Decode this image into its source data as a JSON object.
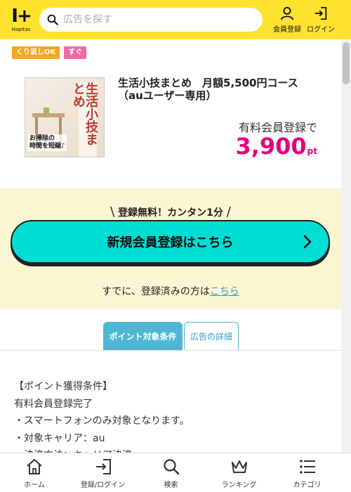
{
  "header": {
    "logo_mark": "I+",
    "logo_word": "Hapitas",
    "search_placeholder": "広告を探す",
    "register_label": "会員登録",
    "login_label": "ログイン"
  },
  "tags": [
    "くり返しOK",
    "すぐ"
  ],
  "product": {
    "image_title": "生活小技まとめ",
    "image_sub": "お掃除の\n時間を短縮♪",
    "title": "生活小技まとめ　月額5,500円コース（auユーザー専用）",
    "reward_label": "有料会員登録で",
    "points": "3,900",
    "points_unit": "pt"
  },
  "registration": {
    "catch": "登録無料！カンタン1分",
    "cta_label": "新規会員登録はこちら",
    "already_text": "すでに、登録済みの方は",
    "already_link": "こちら"
  },
  "tabs": [
    "ポイント対象条件",
    "広告の詳細"
  ],
  "conditions": [
    "【ポイント獲得条件】",
    "有料会員登録完了",
    "・スマートフォンのみ対象となります。",
    "・対象キャリア：au",
    "・決済方法：キャリア決済"
  ],
  "bottom_nav": [
    {
      "label": "ホーム",
      "icon": "home-icon"
    },
    {
      "label": "登録/ログイン",
      "icon": "login-icon"
    },
    {
      "label": "検索",
      "icon": "search-icon"
    },
    {
      "label": "ランキング",
      "icon": "crown-icon"
    },
    {
      "label": "カテゴリ",
      "icon": "list-icon"
    }
  ],
  "colors": {
    "header_bg": "#ffe22e",
    "cta_bg": "#00ded3",
    "points": "#e6007e",
    "panel_bg": "#fbf6d1",
    "tab_active": "#4fb6d4",
    "tag_orange": "#f5a623",
    "tag_pink": "#ee6aa7"
  }
}
